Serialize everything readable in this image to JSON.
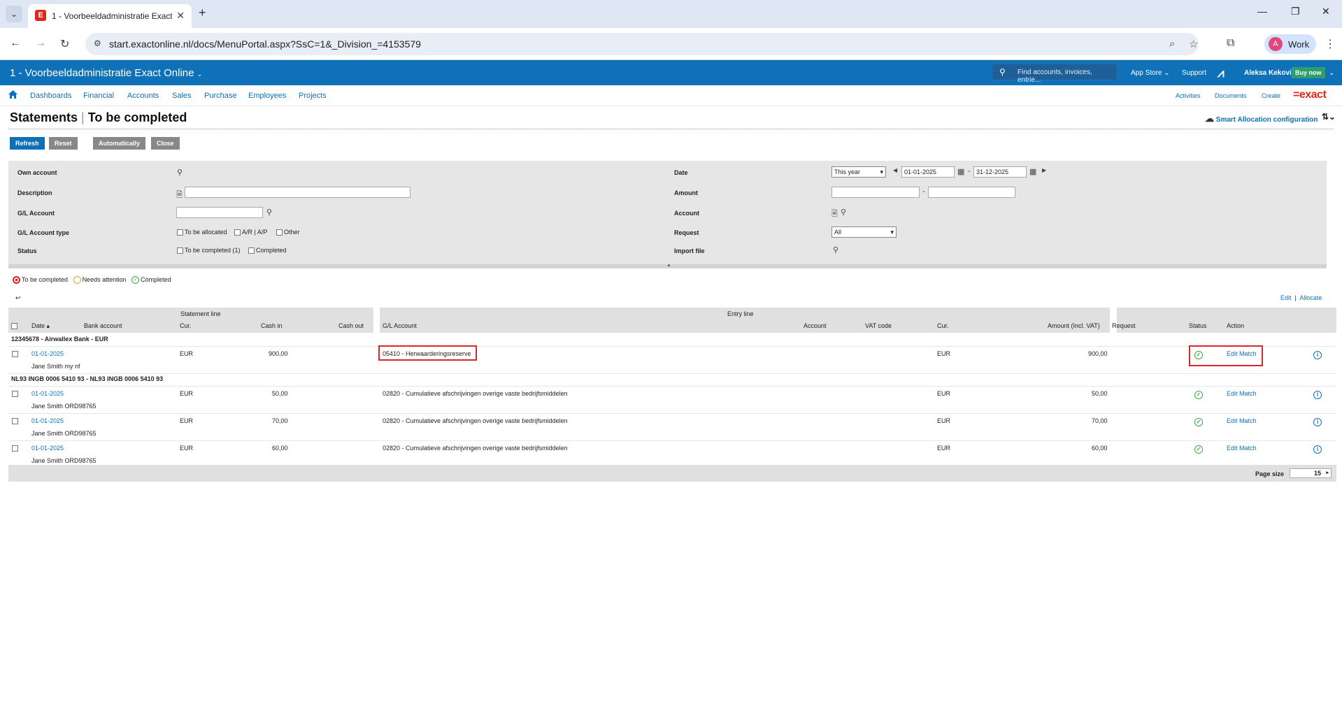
{
  "browser": {
    "tab_title": "1 - Voorbeeldadministratie Exact Online",
    "url": "start.exactonline.nl/docs/MenuPortal.aspx?SsC=1&_Division_=4153579",
    "profile_initial": "A",
    "profile_label": "Work"
  },
  "header": {
    "title": "1 - Voorbeeldadministratie Exact Online",
    "search_placeholder": "Find accounts, invoices, entrie...",
    "app_store": "App Store",
    "support": "Support",
    "user": "Aleksa Kekovic",
    "buy_now": "Buy now"
  },
  "menu": {
    "items": [
      "Dashboards",
      "Financial",
      "Accounts",
      "Sales",
      "Purchase",
      "Employees",
      "Projects"
    ],
    "right": [
      "Activities",
      "Documents",
      "Create"
    ],
    "logo": "=exact"
  },
  "page": {
    "title": "Statements",
    "subtitle": "To be completed",
    "smart_allocation": "Smart Allocation configuration"
  },
  "buttons": {
    "refresh": "Refresh",
    "reset": "Reset",
    "automatically": "Automatically",
    "close": "Close"
  },
  "filters": {
    "own_account": "Own account",
    "description": "Description",
    "gl_account": "G/L Account",
    "gl_account_type": "G/L Account type",
    "status": "Status",
    "type_options": [
      "To be allocated",
      "A/R | A/P",
      "Other"
    ],
    "status_options": [
      "To be completed (1)",
      "Completed"
    ],
    "date": "Date",
    "date_period": "This year",
    "date_from": "01-01-2025",
    "date_to": "31-12-2025",
    "amount": "Amount",
    "account": "Account",
    "request": "Request",
    "request_value": "All",
    "import_file": "Import file"
  },
  "legend": {
    "to_be_completed": "To be completed",
    "needs_attention": "Needs attention",
    "completed": "Completed",
    "colors": {
      "to_be_completed": "#d9262c",
      "needs_attention": "#f0a020",
      "completed": "#3aa845"
    }
  },
  "table_actions": {
    "edit": "Edit",
    "separator": "|",
    "allocate": "Allocate"
  },
  "table": {
    "group_statement": "Statement line",
    "group_entry": "Entry line",
    "headers": {
      "date": "Date",
      "bank_account": "Bank account",
      "cur": "Cur.",
      "cash_in": "Cash in",
      "cash_out": "Cash out",
      "gl_account": "G/L Account",
      "account": "Account",
      "vat_code": "VAT code",
      "cur2": "Cur.",
      "amount": "Amount (Incl. VAT)",
      "request": "Request",
      "status": "Status",
      "action": "Action"
    },
    "groups": [
      {
        "name": "12345678 - Airwallex Bank - EUR",
        "rows": [
          {
            "date": "01-01-2025",
            "desc": "Jane Smith my nf",
            "cur": "EUR",
            "cash_in": "900,00",
            "gl": "05410 - Herwaarderingsreserve",
            "cur2": "EUR",
            "amount": "900,00",
            "action": "Edit Match"
          }
        ]
      },
      {
        "name": "NL93 INGB 0006 5410 93 - NL93 INGB 0006 5410 93",
        "rows": [
          {
            "date": "01-01-2025",
            "desc": "Jane Smith ORD98765",
            "cur": "EUR",
            "cash_in": "50,00",
            "gl": "02820 - Cumulatieve afschrijvingen overige vaste bedrijfsmiddelen",
            "cur2": "EUR",
            "amount": "50,00",
            "action": "Edit Match"
          },
          {
            "date": "01-01-2025",
            "desc": "Jane Smith ORD98765",
            "cur": "EUR",
            "cash_in": "70,00",
            "gl": "02820 - Cumulatieve afschrijvingen overige vaste bedrijfsmiddelen",
            "cur2": "EUR",
            "amount": "70,00",
            "action": "Edit Match"
          },
          {
            "date": "01-01-2025",
            "desc": "Jane Smith ORD98765",
            "cur": "EUR",
            "cash_in": "60,00",
            "gl": "02820 - Cumulatieve afschrijvingen overige vaste bedrijfsmiddelen",
            "cur2": "EUR",
            "amount": "60,00",
            "action": "Edit Match"
          }
        ]
      }
    ]
  },
  "footer": {
    "page_size_label": "Page size",
    "page_size": "15"
  }
}
